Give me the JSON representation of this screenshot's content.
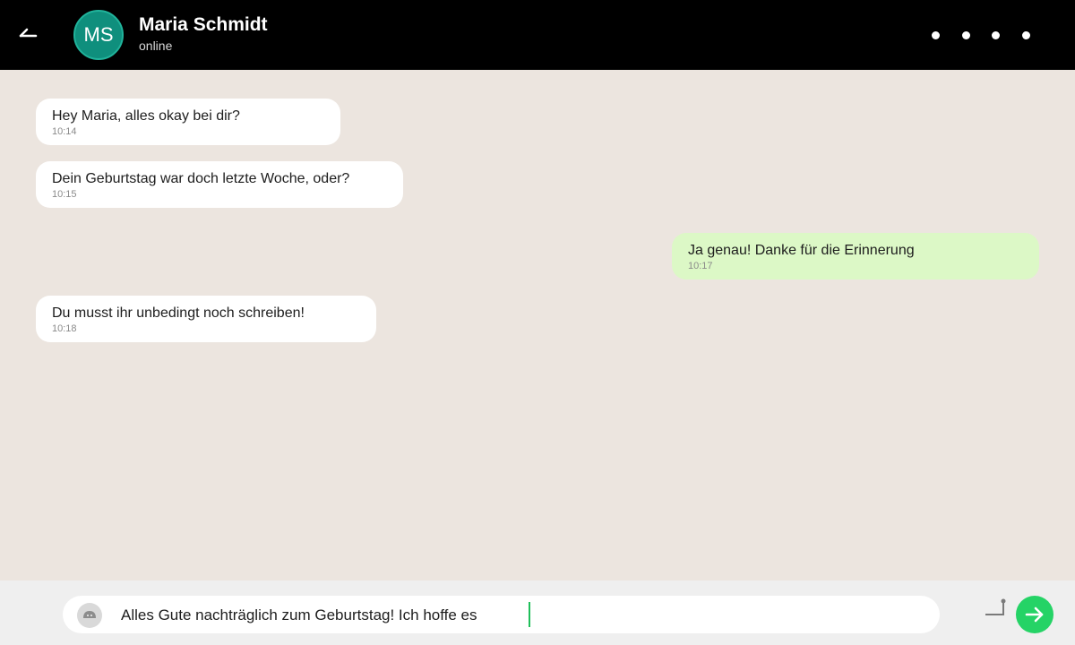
{
  "header": {
    "avatar_initials": "MS",
    "contact_name": "Maria Schmidt",
    "contact_status": "online",
    "back_icon": "back-arrow-icon",
    "menu_icon": "more-options-icon"
  },
  "messages": [
    {
      "direction": "incoming",
      "text": "Hey Maria, alles okay bei dir?",
      "time": "10:14"
    },
    {
      "direction": "incoming",
      "text": "Dein Geburtstag war doch letzte Woche, oder?",
      "time": "10:15"
    },
    {
      "direction": "outgoing",
      "text": "Ja genau! Danke für die Erinnerung",
      "time": "10:17"
    },
    {
      "direction": "incoming",
      "text": "Du musst ihr unbedingt noch schreiben!",
      "time": "10:18"
    }
  ],
  "composer": {
    "value": "Alles Gute nachträglich zum Geburtstag! Ich hoffe es",
    "emoji_icon": "emoji-icon",
    "attach_icon": "attach-icon",
    "send_icon": "send-arrow-icon"
  },
  "colors": {
    "header_bg": "#000000",
    "chat_bg": "#ece5df",
    "incoming_bubble": "#ffffff",
    "outgoing_bubble": "#dcf8c6",
    "accent_green": "#25d366",
    "avatar_bg": "#0f8f7d"
  }
}
